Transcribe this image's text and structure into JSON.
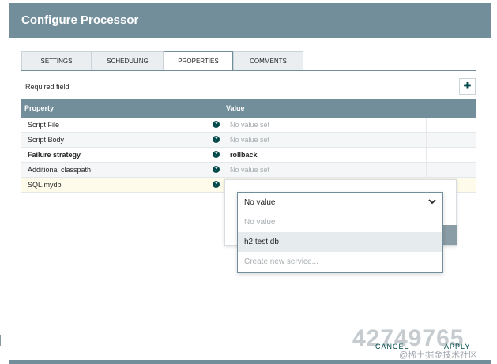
{
  "dialog": {
    "title": "Configure Processor"
  },
  "tabs": [
    {
      "label": "SETTINGS"
    },
    {
      "label": "SCHEDULING"
    },
    {
      "label": "PROPERTIES",
      "active": true
    },
    {
      "label": "COMMENTS"
    }
  ],
  "required_field_label": "Required field",
  "add_button_label": "+",
  "table": {
    "headers": {
      "property": "Property",
      "value": "Value"
    },
    "help_icon_glyph": "?",
    "rows": [
      {
        "property": "Script File",
        "value": "No value set",
        "required": false
      },
      {
        "property": "Script Body",
        "value": "No value set",
        "required": false
      },
      {
        "property": "Failure strategy",
        "value": "rollback",
        "required": true
      },
      {
        "property": "Additional classpath",
        "value": "No value set",
        "required": false
      },
      {
        "property": "SQL.mydb",
        "value": "",
        "required": false,
        "selected": true
      }
    ]
  },
  "combo": {
    "selected": "No value",
    "options": [
      {
        "label": "No value"
      },
      {
        "label": "h2 test db"
      },
      {
        "label": "Create new service..."
      }
    ]
  },
  "footer": {
    "cancel": "CANCEL",
    "apply": "APPLY"
  },
  "watermark": {
    "digits": "42749765",
    "text": "@稀土掘金技术社区"
  },
  "colors": {
    "header": "#728e9b",
    "accent": "#004849",
    "selected_row": "#fffbea",
    "placeholder": "#a7adb0"
  }
}
